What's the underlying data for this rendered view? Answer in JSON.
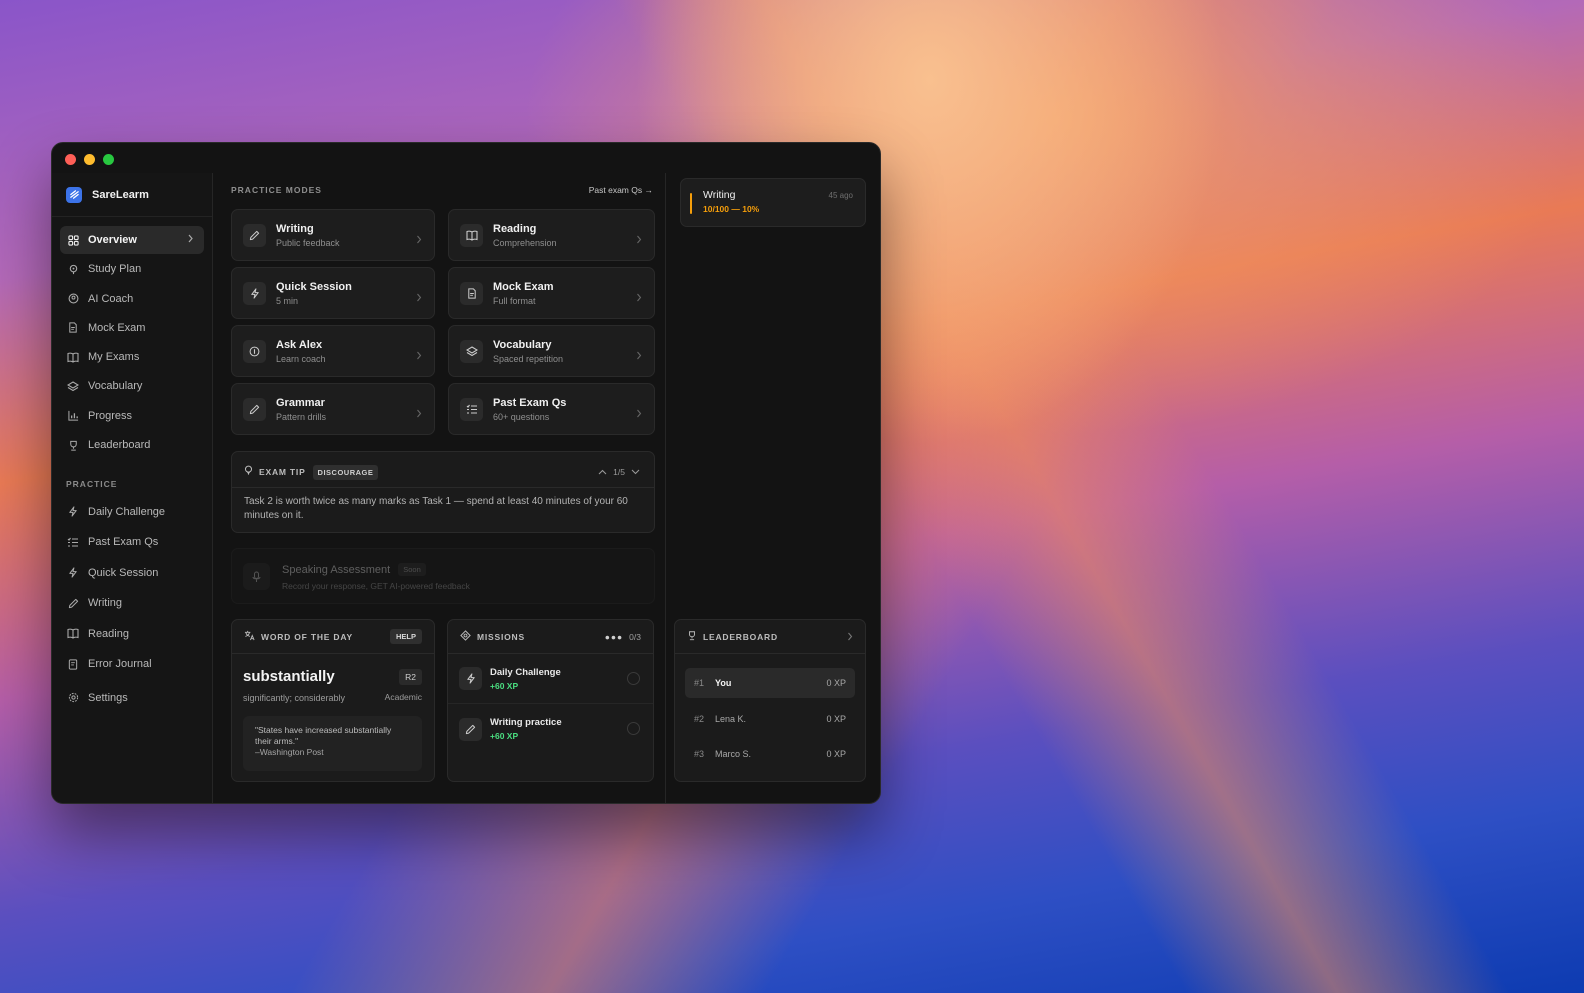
{
  "app": {
    "name": "SareLearm"
  },
  "sidebar": {
    "items": [
      {
        "label": "Overview",
        "icon": "grid-icon"
      },
      {
        "label": "Study Plan",
        "icon": "map-pin-icon"
      },
      {
        "label": "AI Coach",
        "icon": "coach-icon"
      },
      {
        "label": "Mock Exam",
        "icon": "document-icon"
      },
      {
        "label": "My Exams",
        "icon": "book-icon"
      },
      {
        "label": "Vocabulary",
        "icon": "layers-icon"
      },
      {
        "label": "Progress",
        "icon": "bar-chart-icon"
      },
      {
        "label": "Leaderboard",
        "icon": "trophy-icon"
      }
    ],
    "practice_label": "PRACTICE",
    "practice_items": [
      {
        "label": "Daily Challenge",
        "icon": "bolt-icon"
      },
      {
        "label": "Past Exam Qs",
        "icon": "list-icon"
      },
      {
        "label": "Quick Session",
        "icon": "bolt-icon"
      },
      {
        "label": "Writing",
        "icon": "pen-icon"
      },
      {
        "label": "Reading",
        "icon": "book-open-icon"
      },
      {
        "label": "Error Journal",
        "icon": "journal-icon"
      }
    ],
    "settings_label": "Settings"
  },
  "practice_modes": {
    "title": "PRACTICE MODES",
    "link": "Past exam Qs",
    "cards": [
      {
        "title": "Writing",
        "subtitle": "Public feedback"
      },
      {
        "title": "Reading",
        "subtitle": "Comprehension"
      },
      {
        "title": "Quick Session",
        "subtitle": "5 min"
      },
      {
        "title": "Mock Exam",
        "subtitle": "Full format"
      },
      {
        "title": "Ask Alex",
        "subtitle": "Learn coach"
      },
      {
        "title": "Vocabulary",
        "subtitle": "Spaced repetition"
      },
      {
        "title": "Grammar",
        "subtitle": "Pattern drills"
      },
      {
        "title": "Past Exam Qs",
        "subtitle": "60+ questions"
      }
    ]
  },
  "exam_tip": {
    "label": "EXAM TIP",
    "badge": "DISCOURAGE",
    "counter": "1/5",
    "text": "Task 2 is worth twice as many marks as Task 1 — spend at least 40 minutes of your 60 minutes on it."
  },
  "speaking": {
    "title": "Speaking Assessment",
    "badge": "Soon",
    "subtitle": "Record your response, GET AI-powered feedback"
  },
  "word_of_day": {
    "label": "WORD OF THE DAY",
    "help": "HELP",
    "word": "substantially",
    "level": "R2",
    "definition": "significantly; considerably",
    "register": "Academic",
    "quote": "\"States have increased substantially their arms.\"",
    "source": "–Washington Post"
  },
  "missions": {
    "label": "MISSIONS",
    "dots": "●●●",
    "progress": "0/3",
    "items": [
      {
        "title": "Daily Challenge",
        "xp": "+60 XP",
        "done": false
      },
      {
        "title": "Writing practice",
        "xp": "+60 XP",
        "done": false
      }
    ]
  },
  "activity": {
    "title": "Writing",
    "progress_text": "10/100 — 10%",
    "progress": 0.1,
    "ago": "45 ago"
  },
  "leaderboard": {
    "label": "LEADERBOARD",
    "rows": [
      {
        "rank": "#1",
        "name": "You",
        "xp": "0 XP"
      },
      {
        "rank": "#2",
        "name": "Lena K.",
        "xp": "0 XP"
      },
      {
        "rank": "#3",
        "name": "Marco S.",
        "xp": "0 XP"
      }
    ]
  },
  "colors": {
    "accent": "#3c73e8",
    "amber": "#f59e0b",
    "green": "#4ade80"
  }
}
